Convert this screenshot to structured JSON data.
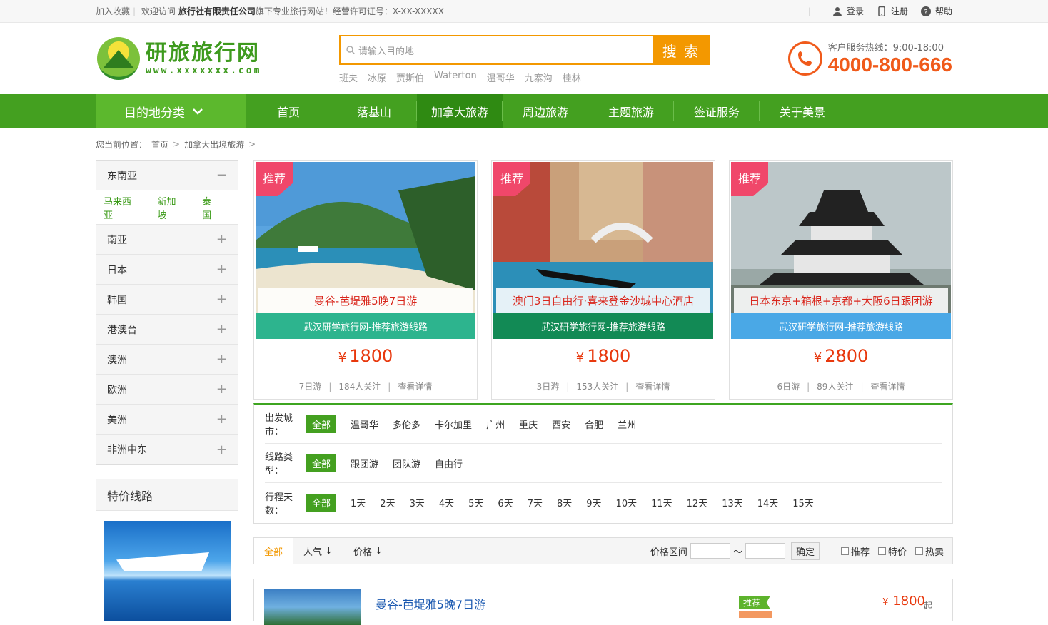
{
  "topbar": {
    "bookmark": "加入收藏",
    "welcome_pre": "欢迎访问",
    "company": "旅行社有限责任公司",
    "welcome_post": "旗下专业旅行网站！经营许可证号：X-XX-XXXXX",
    "login": "登录",
    "register": "注册",
    "help": "帮助"
  },
  "logo": {
    "cn": "研旅旅行网",
    "en": "www.xxxxxxx.com"
  },
  "search": {
    "placeholder": "请输入目的地",
    "button": "搜 索",
    "hot": [
      "班夫",
      "冰原",
      "贾斯伯",
      "Waterton",
      "温哥华",
      "九寨沟",
      "桂林"
    ]
  },
  "hotline": {
    "label": "客户服务热线：9:00-18:00",
    "number": "4000-800-666"
  },
  "nav": {
    "category": "目的地分类",
    "items": [
      "首页",
      "落基山",
      "加拿大旅游",
      "周边旅游",
      "主题旅游",
      "签证服务",
      "关于美景"
    ],
    "active": "加拿大旅游"
  },
  "breadcrumb": {
    "label": "您当前位置：",
    "items": [
      "首页",
      "加拿大出境旅游"
    ]
  },
  "sidebar": {
    "open_group": "东南亚",
    "open_subs": [
      "马来西亚",
      "新加坡",
      "泰国"
    ],
    "groups": [
      "南亚",
      "日本",
      "韩国",
      "港澳台",
      "澳洲",
      "欧洲",
      "美洲",
      "非洲中东"
    ],
    "special_title": "特价线路"
  },
  "cards": [
    {
      "tag": "推荐",
      "title": "曼谷-芭堤雅5晚7日游",
      "band": "武汉研学旅行网-推荐旅游线路",
      "band_color": "#2db48e",
      "currency": "¥",
      "price": "1800",
      "days": "7日游",
      "follows": "184人关注",
      "detail": "查看详情"
    },
    {
      "tag": "推荐",
      "title": "澳门3日自由行·喜来登金沙城中心酒店",
      "band": "武汉研学旅行网-推荐旅游线路",
      "band_color": "#128a55",
      "currency": "¥",
      "price": "1800",
      "days": "3日游",
      "follows": "153人关注",
      "detail": "查看详情"
    },
    {
      "tag": "推荐",
      "title": "日本东京+箱根+京都+大阪6日跟团游",
      "band": "武汉研学旅行网-推荐旅游线路",
      "band_color": "#4aa8e6",
      "currency": "¥",
      "price": "2800",
      "days": "6日游",
      "follows": "89人关注",
      "detail": "查看详情"
    }
  ],
  "filters": {
    "city_label": "出发城市：",
    "cities": [
      "全部",
      "温哥华",
      "多伦多",
      "卡尔加里",
      "广州",
      "重庆",
      "西安",
      "合肥",
      "兰州"
    ],
    "type_label": "线路类型：",
    "types": [
      "全部",
      "跟团游",
      "团队游",
      "自由行"
    ],
    "days_label": "行程天数：",
    "days": [
      "全部",
      "1天",
      "2天",
      "3天",
      "4天",
      "5天",
      "6天",
      "7天",
      "8天",
      "9天",
      "10天",
      "11天",
      "12天",
      "13天",
      "14天",
      "15天"
    ]
  },
  "sort": {
    "tabs": [
      "全部",
      "人气",
      "价格"
    ],
    "price_range": "价格区间",
    "tilde": "～",
    "confirm": "确定",
    "checks": [
      "推荐",
      "特价",
      "热卖"
    ]
  },
  "list_item": {
    "title": "曼谷-芭堤雅5晚7日游",
    "badge": "推荐",
    "currency": "¥",
    "price": "1800",
    "suffix": "起"
  }
}
